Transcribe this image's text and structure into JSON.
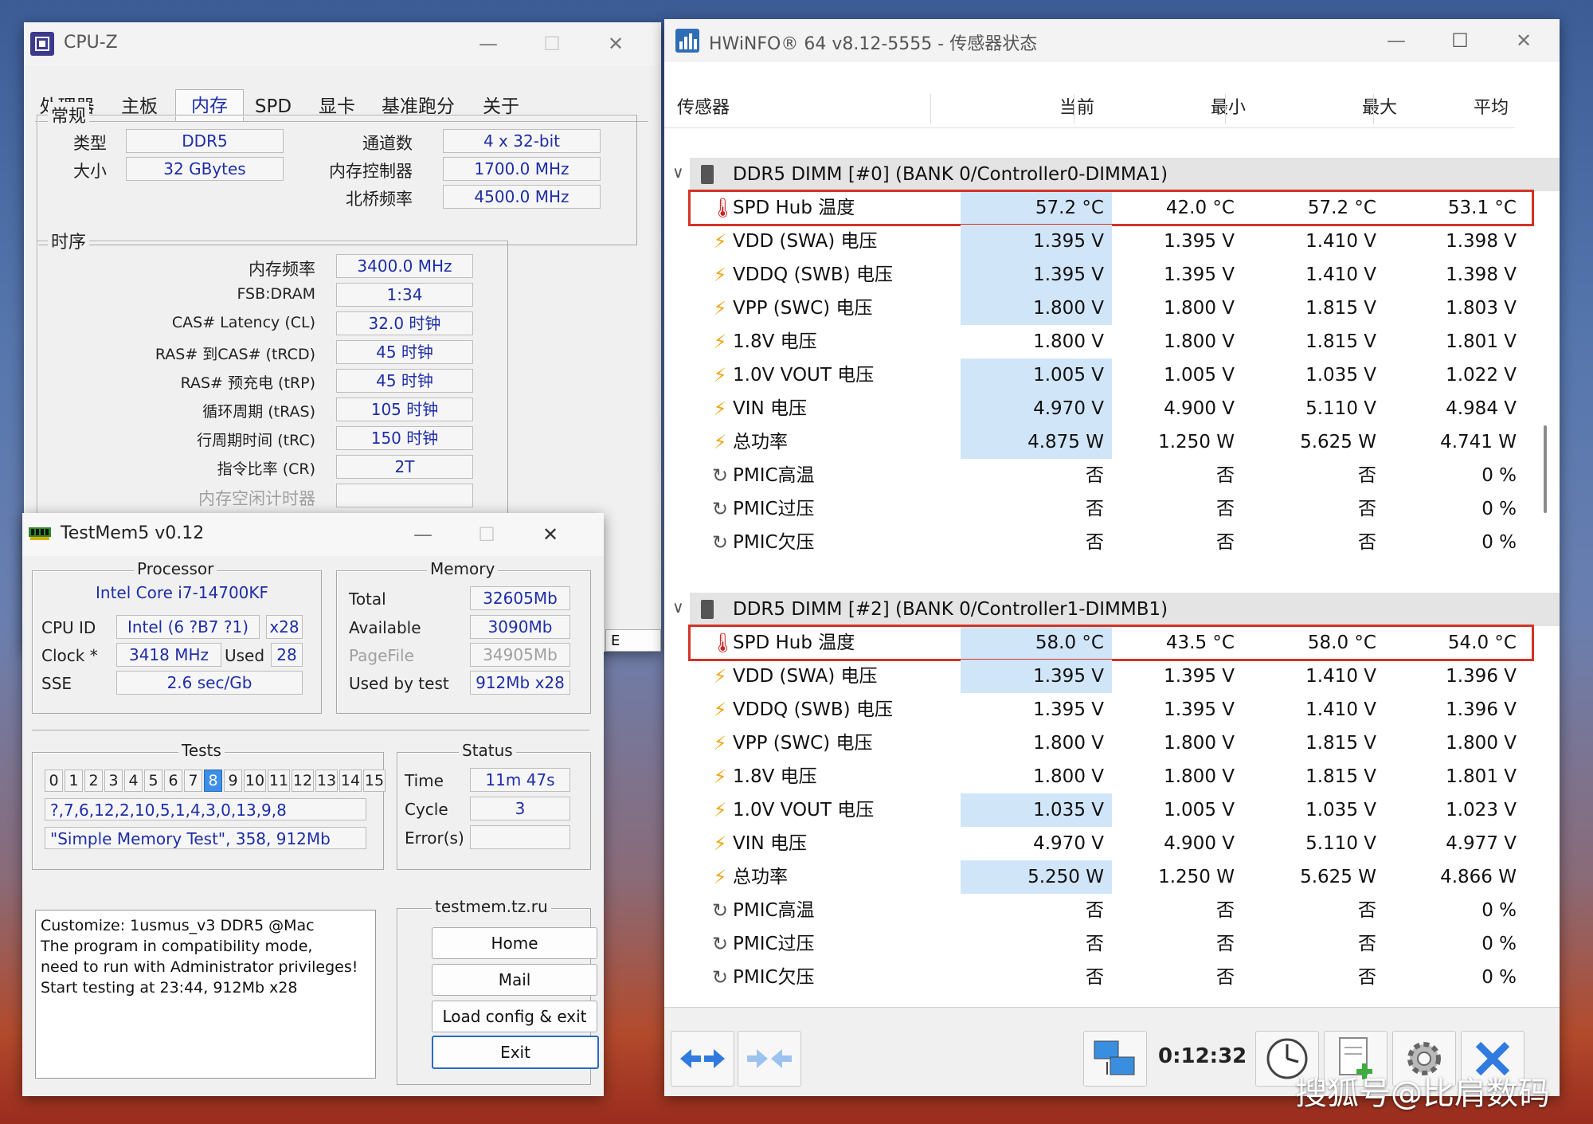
{
  "cpuz": {
    "title": "CPU-Z",
    "tabs": [
      "处理器",
      "主板",
      "内存",
      "SPD",
      "显卡",
      "基准跑分",
      "关于"
    ],
    "general": {
      "legend": "常规",
      "type_label": "类型",
      "type": "DDR5",
      "size_label": "大小",
      "size": "32 GBytes",
      "channels_label": "通道数",
      "channels": "4 x 32-bit",
      "mc_label": "内存控制器",
      "mc": "1700.0 MHz",
      "nb_label": "北桥频率",
      "nb": "4500.0 MHz"
    },
    "timings": {
      "legend": "时序",
      "rows": [
        {
          "label": "内存频率",
          "value": "3400.0 MHz"
        },
        {
          "label": "FSB:DRAM",
          "value": "1:34"
        },
        {
          "label": "CAS# Latency (CL)",
          "value": "32.0 时钟"
        },
        {
          "label": "RAS# 到CAS# (tRCD)",
          "value": "45 时钟"
        },
        {
          "label": "RAS# 预充电 (tRP)",
          "value": "45 时钟"
        },
        {
          "label": "循环周期 (tRAS)",
          "value": "105 时钟"
        },
        {
          "label": "行周期时间 (tRC)",
          "value": "150 时钟"
        },
        {
          "label": "指令比率 (CR)",
          "value": "2T"
        },
        {
          "label": "内存空闲计时器",
          "value": ""
        }
      ]
    },
    "partial_button": "E"
  },
  "testmem": {
    "title": "TestMem5 v0.12",
    "processor": {
      "legend": "Processor",
      "name": "Intel Core i7-14700KF",
      "cpuid_label": "CPU ID",
      "cpuid": "Intel  (6 ?B7 ?1)",
      "cpuid_x": "x28",
      "clock_label": "Clock *",
      "clock": "3418 MHz",
      "used_label": "Used",
      "used": "28",
      "sse_label": "SSE",
      "sse": "2.6 sec/Gb"
    },
    "memory": {
      "legend": "Memory",
      "total_label": "Total",
      "total": "32605Mb",
      "avail_label": "Available",
      "avail": "3090Mb",
      "pagefile_label": "PageFile",
      "pagefile": "34905Mb",
      "usedby_label": "Used by test",
      "usedby": "912Mb x28"
    },
    "tests": {
      "legend": "Tests",
      "cells": [
        "0",
        "1",
        "2",
        "3",
        "4",
        "5",
        "6",
        "7",
        "8",
        "9",
        "10",
        "11",
        "12",
        "13",
        "14",
        "15"
      ],
      "active": 8,
      "sequence": "?,7,6,12,2,10,5,1,4,3,0,13,9,8",
      "current": "\"Simple Memory Test\", 358, 912Mb"
    },
    "status": {
      "legend": "Status",
      "time_label": "Time",
      "time": "11m 47s",
      "cycle_label": "Cycle",
      "cycle": "3",
      "errors_label": "Error(s)",
      "errors": ""
    },
    "log": [
      "Customize: 1usmus_v3 DDR5 @Mac",
      "The program in compatibility mode,",
      "need to run with Administrator privileges!",
      "Start testing at 23:44, 912Mb x28"
    ],
    "site": {
      "legend": "testmem.tz.ru",
      "buttons": [
        "Home",
        "Mail",
        "Load config & exit",
        "Exit"
      ]
    }
  },
  "hwinfo": {
    "title": "HWiNFO® 64 v8.12-5555 - 传感器状态",
    "headers": {
      "sensor": "传感器",
      "current": "当前",
      "min": "最小",
      "max": "最大",
      "avg": "平均"
    },
    "groups": [
      {
        "name": "DDR5 DIMM [#0] (BANK 0/Controller0-DIMMA1)",
        "rows": [
          {
            "icon": "thermometer",
            "name": "SPD Hub 温度",
            "current": "57.2 °C",
            "min": "42.0 °C",
            "max": "57.2 °C",
            "avg": "53.1 °C",
            "highlight": true,
            "outlined": true
          },
          {
            "icon": "bolt",
            "name": "VDD (SWA) 电压",
            "current": "1.395 V",
            "min": "1.395 V",
            "max": "1.410 V",
            "avg": "1.398 V",
            "highlight": true
          },
          {
            "icon": "bolt",
            "name": "VDDQ (SWB) 电压",
            "current": "1.395 V",
            "min": "1.395 V",
            "max": "1.410 V",
            "avg": "1.398 V",
            "highlight": true
          },
          {
            "icon": "bolt",
            "name": "VPP (SWC) 电压",
            "current": "1.800 V",
            "min": "1.800 V",
            "max": "1.815 V",
            "avg": "1.803 V",
            "highlight": true
          },
          {
            "icon": "bolt",
            "name": "1.8V 电压",
            "current": "1.800 V",
            "min": "1.800 V",
            "max": "1.815 V",
            "avg": "1.801 V",
            "highlight": false
          },
          {
            "icon": "bolt",
            "name": "1.0V VOUT 电压",
            "current": "1.005 V",
            "min": "1.005 V",
            "max": "1.035 V",
            "avg": "1.022 V",
            "highlight": true
          },
          {
            "icon": "bolt",
            "name": "VIN 电压",
            "current": "4.970 V",
            "min": "4.900 V",
            "max": "5.110 V",
            "avg": "4.984 V",
            "highlight": true
          },
          {
            "icon": "bolt",
            "name": "总功率",
            "current": "4.875 W",
            "min": "1.250 W",
            "max": "5.625 W",
            "avg": "4.741 W",
            "highlight": true
          },
          {
            "icon": "clock",
            "name": "PMIC高温",
            "current": "否",
            "min": "否",
            "max": "否",
            "avg": "0 %",
            "highlight": false
          },
          {
            "icon": "clock",
            "name": "PMIC过压",
            "current": "否",
            "min": "否",
            "max": "否",
            "avg": "0 %",
            "highlight": false
          },
          {
            "icon": "clock",
            "name": "PMIC欠压",
            "current": "否",
            "min": "否",
            "max": "否",
            "avg": "0 %",
            "highlight": false
          }
        ]
      },
      {
        "name": "DDR5 DIMM [#2] (BANK 0/Controller1-DIMMB1)",
        "rows": [
          {
            "icon": "thermometer",
            "name": "SPD Hub 温度",
            "current": "58.0 °C",
            "min": "43.5 °C",
            "max": "58.0 °C",
            "avg": "54.0 °C",
            "highlight": true,
            "outlined": true
          },
          {
            "icon": "bolt",
            "name": "VDD (SWA) 电压",
            "current": "1.395 V",
            "min": "1.395 V",
            "max": "1.410 V",
            "avg": "1.396 V",
            "highlight": true
          },
          {
            "icon": "bolt",
            "name": "VDDQ (SWB) 电压",
            "current": "1.395 V",
            "min": "1.395 V",
            "max": "1.410 V",
            "avg": "1.396 V",
            "highlight": false
          },
          {
            "icon": "bolt",
            "name": "VPP (SWC) 电压",
            "current": "1.800 V",
            "min": "1.800 V",
            "max": "1.815 V",
            "avg": "1.800 V",
            "highlight": false
          },
          {
            "icon": "bolt",
            "name": "1.8V 电压",
            "current": "1.800 V",
            "min": "1.800 V",
            "max": "1.815 V",
            "avg": "1.801 V",
            "highlight": false
          },
          {
            "icon": "bolt",
            "name": "1.0V VOUT 电压",
            "current": "1.035 V",
            "min": "1.005 V",
            "max": "1.035 V",
            "avg": "1.023 V",
            "highlight": true
          },
          {
            "icon": "bolt",
            "name": "VIN 电压",
            "current": "4.970 V",
            "min": "4.900 V",
            "max": "5.110 V",
            "avg": "4.977 V",
            "highlight": false
          },
          {
            "icon": "bolt",
            "name": "总功率",
            "current": "5.250 W",
            "min": "1.250 W",
            "max": "5.625 W",
            "avg": "4.866 W",
            "highlight": true
          },
          {
            "icon": "clock",
            "name": "PMIC高温",
            "current": "否",
            "min": "否",
            "max": "否",
            "avg": "0 %",
            "highlight": false
          },
          {
            "icon": "clock",
            "name": "PMIC过压",
            "current": "否",
            "min": "否",
            "max": "否",
            "avg": "0 %",
            "highlight": false
          },
          {
            "icon": "clock",
            "name": "PMIC欠压",
            "current": "否",
            "min": "否",
            "max": "否",
            "avg": "0 %",
            "highlight": false
          }
        ]
      }
    ],
    "timer": "0:12:32"
  },
  "watermark": "搜狐号@比肩数码",
  "colors": {
    "accent_blue": "#1e2ea8",
    "highlight": "#d1e5f8",
    "outline_red": "#d33326",
    "bolt": "#f3a51b"
  }
}
